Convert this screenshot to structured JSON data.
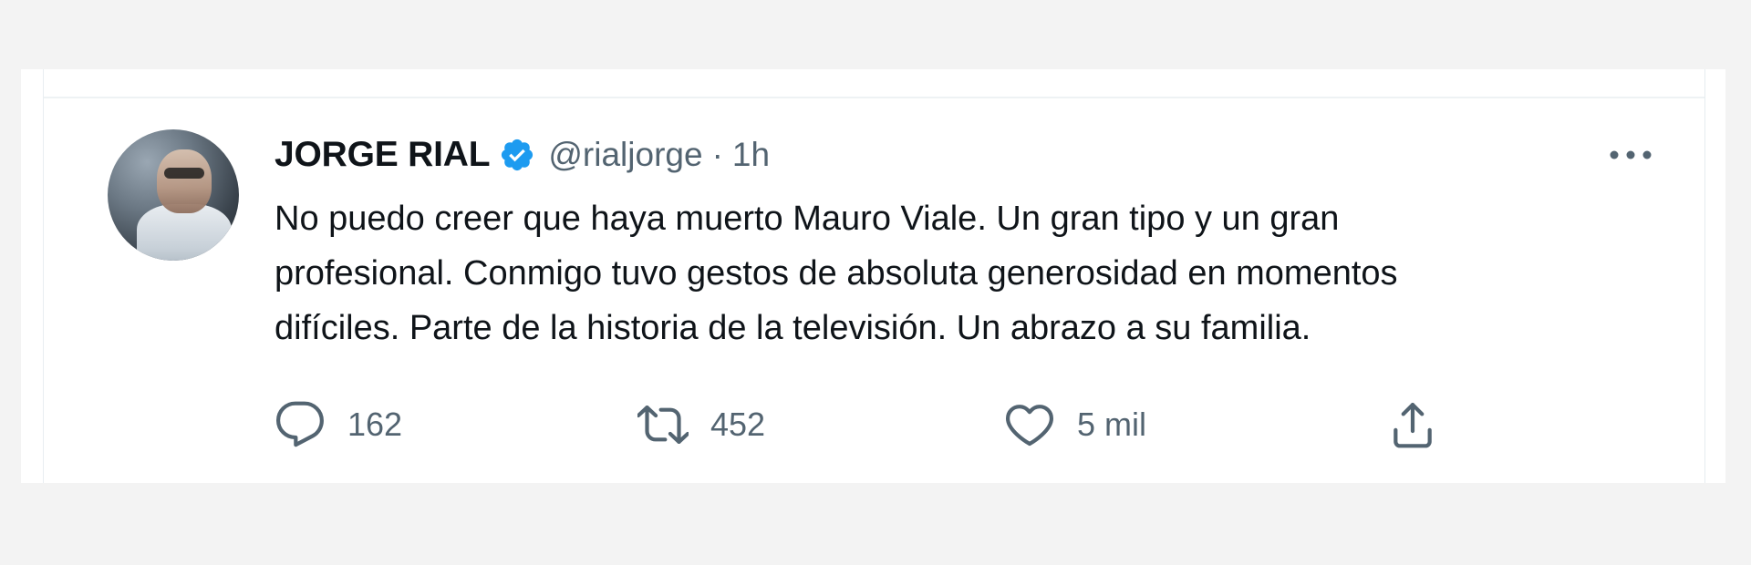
{
  "tweet": {
    "author": {
      "display_name": "JORGE RIAL",
      "handle": "@rialjorge",
      "verified": true,
      "avatar_icon": "profile-photo"
    },
    "meta": {
      "separator": "·",
      "time": "1h"
    },
    "text": "No puedo creer que haya muerto Mauro Viale. Un gran tipo y un gran\nprofesional. Conmigo tuvo gestos de absoluta generosidad en momentos\ndifíciles. Parte de la historia de la televisión. Un abrazo a su familia.",
    "actions": {
      "reply": {
        "icon": "reply-icon",
        "count": "162"
      },
      "retweet": {
        "icon": "retweet-icon",
        "count": "452"
      },
      "like": {
        "icon": "heart-icon",
        "count": "5 mil"
      },
      "share": {
        "icon": "share-icon"
      }
    },
    "more_icon": "more-icon"
  },
  "colors": {
    "text_primary": "#0f1419",
    "text_secondary": "#536471",
    "verified_blue": "#1d9bf0",
    "background": "#f3f3f3",
    "card_background": "#ffffff",
    "divider": "#eef2f4"
  }
}
